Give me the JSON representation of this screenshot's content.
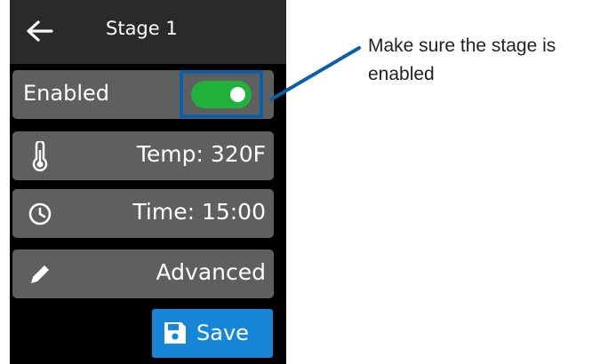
{
  "header": {
    "back_icon": "arrow-left-icon",
    "title": "Stage 1"
  },
  "stage": {
    "enabled_label": "Enabled",
    "enabled": true,
    "temperature_label": "Temp: 320F",
    "temperature_icon": "thermometer-icon",
    "time_label": "Time: 15:00",
    "time_icon": "clock-icon",
    "advanced_label": "Advanced",
    "advanced_icon": "pencil-icon"
  },
  "actions": {
    "save_label": "Save",
    "save_icon": "floppy-disk-icon"
  },
  "annotation": {
    "text": "Make sure the stage is enabled"
  },
  "colors": {
    "toggle_on": "#21b23b",
    "save_button": "#1686d6",
    "callout": "#0d5ea8",
    "row_background": "#5f5f5f",
    "device_background": "#000000"
  }
}
